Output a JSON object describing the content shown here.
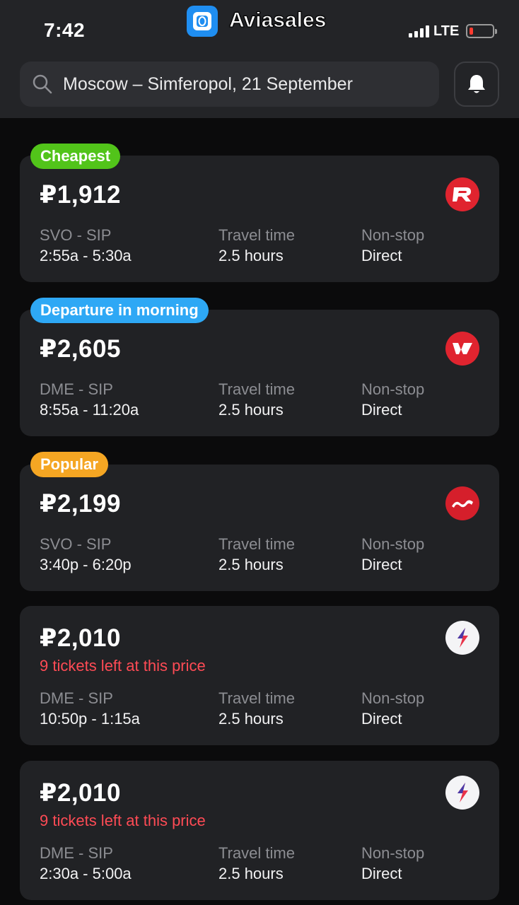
{
  "status_bar": {
    "time": "7:42",
    "network": "LTE"
  },
  "app": {
    "name": "Aviasales"
  },
  "search": {
    "query": "Moscow – Simferopol, 21 September"
  },
  "colors": {
    "cheapest": "#52c41a",
    "morning": "#2ea8f5",
    "popular": "#f5a623",
    "warning": "#ff4b55"
  },
  "flights": [
    {
      "badge": "Cheapest",
      "price": "₽1,912",
      "route": "SVO - SIP",
      "times": "2:55a - 5:30a",
      "travel_label": "Travel time",
      "travel_value": "2.5 hours",
      "stops_label": "Non-stop",
      "stops_value": "Direct",
      "airline_icon": "rossiya-logo-icon"
    },
    {
      "badge": "Departure in morning",
      "price": "₽2,605",
      "route": "DME - SIP",
      "times": "8:55a - 11:20a",
      "travel_label": "Travel time",
      "travel_value": "2.5 hours",
      "stops_label": "Non-stop",
      "stops_value": "Direct",
      "airline_icon": "red-wings-logo-icon"
    },
    {
      "badge": "Popular",
      "price": "₽2,199",
      "route": "SVO - SIP",
      "times": "3:40p - 6:20p",
      "travel_label": "Travel time",
      "travel_value": "2.5 hours",
      "stops_label": "Non-stop",
      "stops_value": "Direct",
      "airline_icon": "nordwind-logo-icon"
    },
    {
      "price": "₽2,010",
      "warning": "9 tickets left at this price",
      "route": "DME - SIP",
      "times": "10:50p - 1:15a",
      "travel_label": "Travel time",
      "travel_value": "2.5 hours",
      "stops_label": "Non-stop",
      "stops_value": "Direct",
      "airline_icon": "smartavia-logo-icon"
    },
    {
      "price": "₽2,010",
      "warning": "9 tickets left at this price",
      "route": "DME - SIP",
      "times": "2:30a - 5:00a",
      "travel_label": "Travel time",
      "travel_value": "2.5 hours",
      "stops_label": "Non-stop",
      "stops_value": "Direct",
      "airline_icon": "smartavia-logo-icon"
    }
  ]
}
